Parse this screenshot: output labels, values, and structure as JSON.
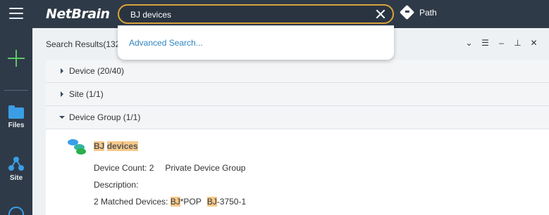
{
  "app": {
    "logo": "NetBrain"
  },
  "search": {
    "value": "BJ devices",
    "advanced_label": "Advanced Search..."
  },
  "toolbar": {
    "path_label": "Path"
  },
  "rail": {
    "files_label": "Files",
    "site_label": "Site"
  },
  "panel": {
    "title": "Search Results(132",
    "tools": [
      "chevron-down-icon",
      "list-icon",
      "minimize-icon",
      "pin-icon",
      "close-icon"
    ]
  },
  "groups": [
    {
      "label": "Device (20/40)",
      "expanded": false
    },
    {
      "label": "Site (1/1)",
      "expanded": false
    },
    {
      "label": "Device Group (1/1)",
      "expanded": true
    }
  ],
  "result": {
    "title_hl1": "BJ",
    "title_hl2": "devices",
    "count_text": "Device Count: 2",
    "type_text": "Private Device Group",
    "description_label": "Description:",
    "matched_prefix": "2 Matched Devices:",
    "dev1_hl": "BJ",
    "dev1_rest": "*POP",
    "dev2_hl": "BJ",
    "dev2_rest": "-3750-1"
  },
  "colors": {
    "accent": "#d9a33a",
    "rail_bg": "#2f3a48",
    "highlight": "#f7c98b",
    "link": "#2e86c1"
  }
}
